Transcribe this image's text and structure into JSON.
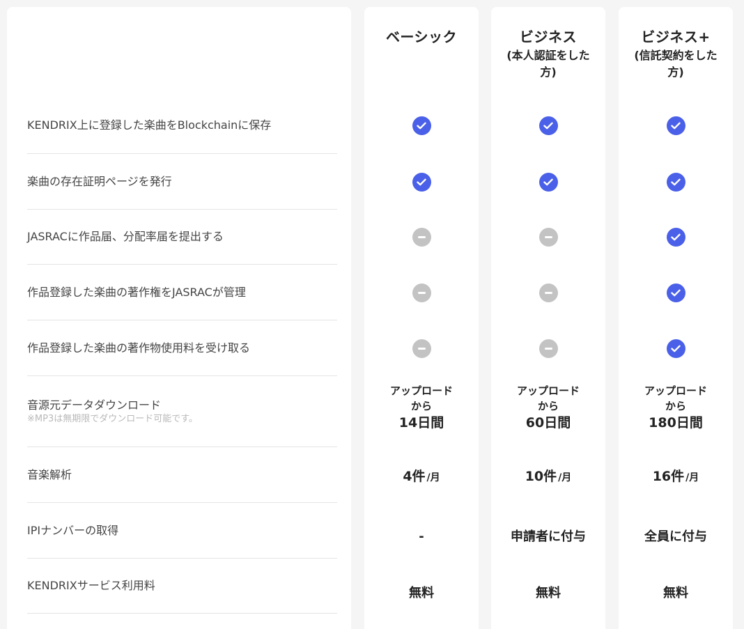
{
  "features": [
    {
      "label": "KENDRIX上に登録した楽曲をBlockchainに保存"
    },
    {
      "label": "楽曲の存在証明ページを発行"
    },
    {
      "label": "JASRACに作品届、分配率届を提出する"
    },
    {
      "label": "作品登録した楽曲の著作権をJASRACが管理"
    },
    {
      "label": "作品登録した楽曲の著作物使用料を受け取る"
    },
    {
      "label": "音源元データダウンロード",
      "note": "※MP3は無期限でダウンロード可能です。"
    },
    {
      "label": "音楽解析"
    },
    {
      "label": "IPIナンバーの取得"
    },
    {
      "label": "KENDRIXサービス利用料"
    }
  ],
  "plans": [
    {
      "name": "ベーシック",
      "subtitle": "",
      "features": [
        "check-icon",
        "check-icon",
        "unavailable-icon",
        "unavailable-icon",
        "unavailable-icon"
      ],
      "download": {
        "line1": "アップロード",
        "line2": "から",
        "period": "14日間"
      },
      "analysis": {
        "count": "4件",
        "unit": "/月"
      },
      "ipi": "-",
      "fee": "無料"
    },
    {
      "name": "ビジネス",
      "subtitle": "(本人認証をした方)",
      "features": [
        "check-icon",
        "check-icon",
        "unavailable-icon",
        "unavailable-icon",
        "unavailable-icon"
      ],
      "download": {
        "line1": "アップロード",
        "line2": "から",
        "period": "60日間"
      },
      "analysis": {
        "count": "10件",
        "unit": "/月"
      },
      "ipi": "申請者に付与",
      "fee": "無料"
    },
    {
      "name": "ビジネス+",
      "subtitle": "(信託契約をした方)",
      "features": [
        "check-icon",
        "check-icon",
        "check-icon",
        "check-icon",
        "check-icon"
      ],
      "download": {
        "line1": "アップロード",
        "line2": "から",
        "period": "180日間"
      },
      "analysis": {
        "count": "16件",
        "unit": "/月"
      },
      "ipi": "全員に付与",
      "fee": "無料"
    }
  ],
  "colors": {
    "check": "#4a60e8",
    "unavailable": "#c3c3c3",
    "background": "#f5f5f6",
    "card": "#ffffff"
  }
}
